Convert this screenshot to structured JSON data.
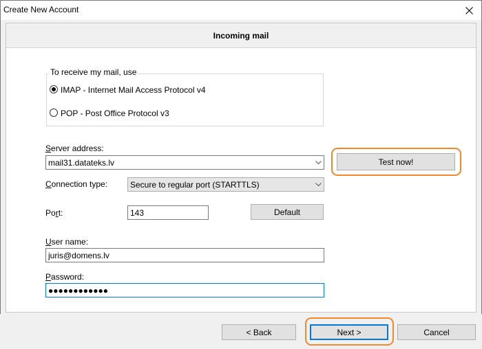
{
  "window": {
    "title": "Create New Account"
  },
  "header": {
    "title": "Incoming mail"
  },
  "group": {
    "legend": "To receive my mail, use",
    "imap_label": "IMAP - Internet Mail Access Protocol v4",
    "pop_label": "POP  -  Post Office Protocol v3",
    "selected": "IMAP"
  },
  "server": {
    "label_ul": "S",
    "label_rest": "erver address:",
    "value": "mail31.datateks.lv",
    "test_label": "Test now!"
  },
  "connection": {
    "label_ul": "C",
    "label_rest": "onnection type:",
    "value": "Secure to regular port (STARTTLS)"
  },
  "port": {
    "label_pre": "Po",
    "label_ul": "r",
    "label_rest": "t:",
    "value": "143",
    "default_label": "Default"
  },
  "username": {
    "label_ul": "U",
    "label_rest": "ser name:",
    "value": "juris@domens.lv"
  },
  "password": {
    "label_ul": "P",
    "label_rest": "assword:",
    "value": "●●●●●●●●●●●●"
  },
  "footer": {
    "back_label": "<  Back",
    "next_label": "Next   >",
    "cancel_label": "Cancel"
  },
  "colors": {
    "highlight": "#f0882c",
    "focus": "#0078d7"
  }
}
